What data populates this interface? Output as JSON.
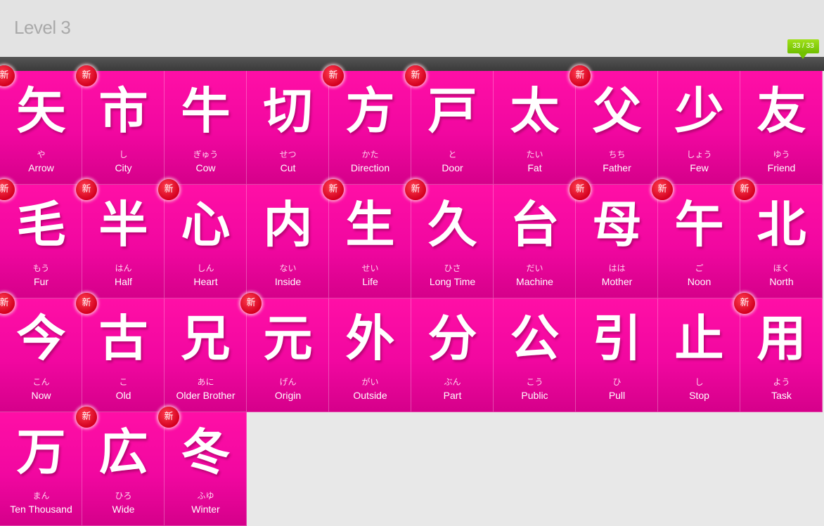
{
  "header": {
    "title": "Level 3",
    "progress": "33 / 33"
  },
  "badge_label": "新",
  "cards": [
    {
      "kanji": "矢",
      "reading": "や",
      "meaning": "Arrow",
      "new": true
    },
    {
      "kanji": "市",
      "reading": "し",
      "meaning": "City",
      "new": true
    },
    {
      "kanji": "牛",
      "reading": "ぎゅう",
      "meaning": "Cow",
      "new": false
    },
    {
      "kanji": "切",
      "reading": "せつ",
      "meaning": "Cut",
      "new": false
    },
    {
      "kanji": "方",
      "reading": "かた",
      "meaning": "Direction",
      "new": true
    },
    {
      "kanji": "戸",
      "reading": "と",
      "meaning": "Door",
      "new": true
    },
    {
      "kanji": "太",
      "reading": "たい",
      "meaning": "Fat",
      "new": false
    },
    {
      "kanji": "父",
      "reading": "ちち",
      "meaning": "Father",
      "new": true
    },
    {
      "kanji": "少",
      "reading": "しょう",
      "meaning": "Few",
      "new": false
    },
    {
      "kanji": "友",
      "reading": "ゆう",
      "meaning": "Friend",
      "new": false
    },
    {
      "kanji": "毛",
      "reading": "もう",
      "meaning": "Fur",
      "new": true
    },
    {
      "kanji": "半",
      "reading": "はん",
      "meaning": "Half",
      "new": true
    },
    {
      "kanji": "心",
      "reading": "しん",
      "meaning": "Heart",
      "new": true
    },
    {
      "kanji": "内",
      "reading": "ない",
      "meaning": "Inside",
      "new": false
    },
    {
      "kanji": "生",
      "reading": "せい",
      "meaning": "Life",
      "new": true
    },
    {
      "kanji": "久",
      "reading": "ひさ",
      "meaning": "Long Time",
      "new": true
    },
    {
      "kanji": "台",
      "reading": "だい",
      "meaning": "Machine",
      "new": false
    },
    {
      "kanji": "母",
      "reading": "はは",
      "meaning": "Mother",
      "new": true
    },
    {
      "kanji": "午",
      "reading": "ご",
      "meaning": "Noon",
      "new": true
    },
    {
      "kanji": "北",
      "reading": "ほく",
      "meaning": "North",
      "new": true
    },
    {
      "kanji": "今",
      "reading": "こん",
      "meaning": "Now",
      "new": true
    },
    {
      "kanji": "古",
      "reading": "こ",
      "meaning": "Old",
      "new": true
    },
    {
      "kanji": "兄",
      "reading": "あに",
      "meaning": "Older Brother",
      "new": false
    },
    {
      "kanji": "元",
      "reading": "げん",
      "meaning": "Origin",
      "new": true
    },
    {
      "kanji": "外",
      "reading": "がい",
      "meaning": "Outside",
      "new": false
    },
    {
      "kanji": "分",
      "reading": "ぶん",
      "meaning": "Part",
      "new": false
    },
    {
      "kanji": "公",
      "reading": "こう",
      "meaning": "Public",
      "new": false
    },
    {
      "kanji": "引",
      "reading": "ひ",
      "meaning": "Pull",
      "new": false
    },
    {
      "kanji": "止",
      "reading": "し",
      "meaning": "Stop",
      "new": false
    },
    {
      "kanji": "用",
      "reading": "よう",
      "meaning": "Task",
      "new": true
    },
    {
      "kanji": "万",
      "reading": "まん",
      "meaning": "Ten Thousand",
      "new": false
    },
    {
      "kanji": "広",
      "reading": "ひろ",
      "meaning": "Wide",
      "new": true
    },
    {
      "kanji": "冬",
      "reading": "ふゆ",
      "meaning": "Winter",
      "new": true
    }
  ],
  "colors": {
    "card": "#f107a0",
    "badge": "#e8102a",
    "progress": "#8cd40a"
  }
}
